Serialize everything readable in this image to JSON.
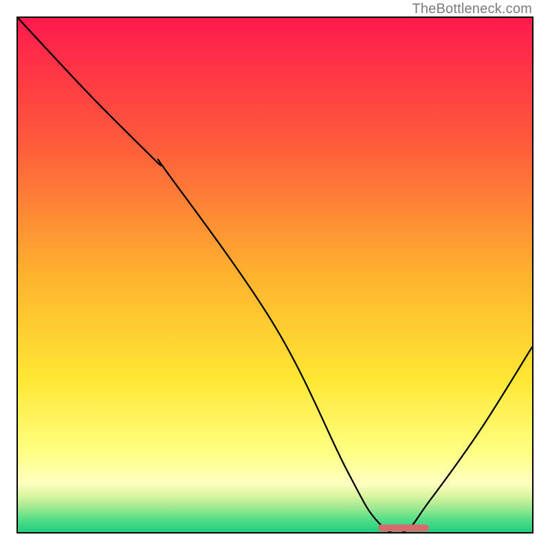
{
  "attribution": "TheBottleneck.com",
  "chart_data": {
    "type": "line",
    "title": "",
    "xlabel": "",
    "ylabel": "",
    "xlim": [
      0,
      100
    ],
    "ylim": [
      0,
      100
    ],
    "series": [
      {
        "name": "curve",
        "x": [
          0,
          14,
          27,
          29,
          50,
          64,
          70,
          75,
          80,
          90,
          100
        ],
        "values": [
          100,
          85,
          72,
          70,
          40,
          12,
          2,
          0,
          6,
          20,
          36
        ]
      }
    ],
    "gradient_stops": [
      {
        "pos": 0.0,
        "color": "#ff1a4d"
      },
      {
        "pos": 0.25,
        "color": "#ff5d3b"
      },
      {
        "pos": 0.5,
        "color": "#ffb22e"
      },
      {
        "pos": 0.7,
        "color": "#ffe633"
      },
      {
        "pos": 0.84,
        "color": "#ffff80"
      },
      {
        "pos": 0.905,
        "color": "#ffffc0"
      },
      {
        "pos": 0.93,
        "color": "#d8f5a0"
      },
      {
        "pos": 0.955,
        "color": "#98e890"
      },
      {
        "pos": 0.975,
        "color": "#55dd88"
      },
      {
        "pos": 1.0,
        "color": "#1fcf7f"
      }
    ],
    "optimal_marker": {
      "x_start": 70,
      "x_end": 80,
      "y": 0,
      "color": "#d96a6d"
    }
  }
}
